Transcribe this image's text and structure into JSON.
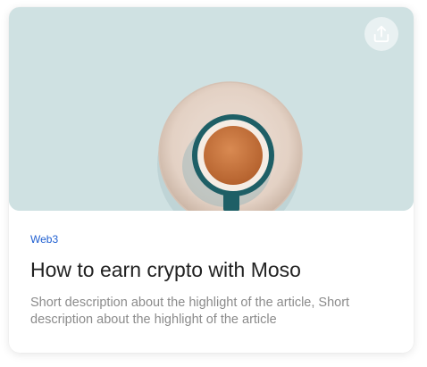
{
  "article": {
    "category": "Web3",
    "title": "How to earn crypto with Moso",
    "description": "Short description about the highlight of the article, Short description about the highlight of the article"
  },
  "hero": {
    "image_alt": "cup of coffee on saucer",
    "background_color": "#cfe1e2"
  },
  "icons": {
    "share": "share-upload-icon"
  },
  "colors": {
    "category": "#1f5fd1",
    "title": "#222222",
    "description": "#8b8b8b"
  }
}
